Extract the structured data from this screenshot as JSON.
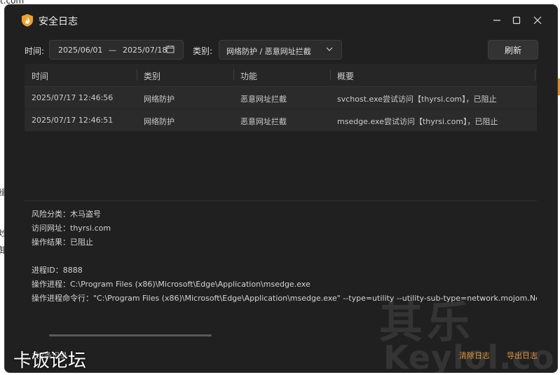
{
  "window": {
    "title": "安全日志",
    "icon": "shield-flame-icon"
  },
  "filters": {
    "time_label": "时间:",
    "date_start": "2025/06/01",
    "date_sep": "—",
    "date_end": "2025/07/18",
    "category_label": "类别:",
    "category_value": "网络防护 / 恶意网址拦截",
    "refresh_label": "刷新"
  },
  "table": {
    "headers": [
      "时间",
      "类别",
      "功能",
      "概要"
    ],
    "rows": [
      {
        "time": "2025/07/17 12:46:56",
        "category": "网络防护",
        "function": "恶意网址拦截",
        "summary": "svchost.exe尝试访问【thyrsi.com】，已阻止"
      },
      {
        "time": "2025/07/17 12:46:51",
        "category": "网络防护",
        "function": "恶意网址拦截",
        "summary": "msedge.exe尝试访问【thyrsi.com】，已阻止"
      }
    ]
  },
  "detail": {
    "risk": "风险分类：木马盗号",
    "url": "访问网址：thyrsi.com",
    "result": "操作结果：已阻止",
    "pid": "进程ID：8888",
    "process": "操作进程：C:\\Program Files (x86)\\Microsoft\\Edge\\Application\\msedge.exe",
    "cmdline": "操作进程命令行：\"C:\\Program Files (x86)\\Microsoft\\Edge\\Application\\msedge.exe\" --type=utility --utility-sub-type=network.mojom.NetworkSer"
  },
  "footer": {
    "left_text": "共2条记录",
    "clear_log": "清除日志",
    "export_log": "导出日志"
  },
  "watermark": {
    "big": "其乐",
    "latin": "Keylol.com",
    "cn": "卡饭论坛"
  },
  "background": {
    "frag_top": "t.com",
    "frag_left1": "缉",
    "frag_left2": "炒",
    "frag_left3": "卸"
  },
  "colors": {
    "accent": "#e0902e",
    "window_bg": "#202020"
  }
}
